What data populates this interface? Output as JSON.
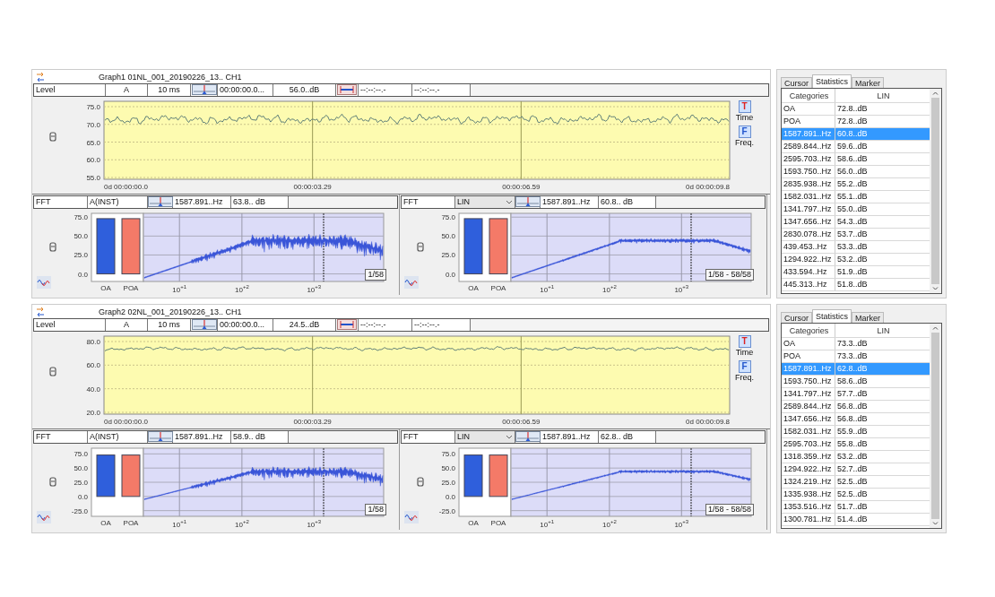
{
  "graphs": [
    {
      "title": "Graph1 01NL_001_20190226_13.. CH1",
      "level_toolbar": {
        "mode": "Level",
        "weighting": "A",
        "interval": "10 ms",
        "time": "00:00:00.0...",
        "value": "56.0..dB",
        "range_start": "--:--:--.-",
        "range_end": "--:--:--.-"
      },
      "level_chart": {
        "y_labels": [
          "75.0",
          "70.0",
          "65.0",
          "60.0",
          "55.0"
        ],
        "x_labels": [
          "0d 00:00:00.0",
          "00:00:03.29",
          "00:00:06.59",
          "0d 00:00:09.8"
        ]
      },
      "view_buttons": [
        {
          "icon": "T",
          "label": "Time"
        },
        {
          "icon": "F",
          "label": "Freq."
        }
      ],
      "fft_panes": [
        {
          "kind": "field",
          "mode": "FFT",
          "weighting": "A(INST)",
          "frequency": "1587.891..Hz",
          "value": "63.8.. dB",
          "page": "1/58",
          "x_labels": [
            "10$^{+1}$",
            "10$^{+2}$",
            "10$^{+3}$"
          ],
          "chart_data": {
            "type": "bar",
            "categories": [
              "OA",
              "POA"
            ],
            "values": [
              73,
              73
            ],
            "ylim": [
              -10,
              80
            ],
            "yticks": [
              {
                "value": 75,
                "label": "75.0"
              },
              {
                "value": 50,
                "label": "50.0"
              },
              {
                "value": 25,
                "label": "25.0"
              },
              {
                "value": 0,
                "label": "0.0"
              }
            ]
          }
        },
        {
          "kind": "dropdown",
          "mode": "FFT",
          "weighting": "LIN",
          "frequency": "1587.891..Hz",
          "value": "60.8.. dB",
          "page": "1/58 - 58/58",
          "x_labels": [
            "10$^{+1}$",
            "10$^{+2}$",
            "10$^{+3}$"
          ],
          "chart_data": {
            "type": "bar",
            "categories": [
              "OA",
              "POA"
            ],
            "values": [
              73,
              73
            ],
            "ylim": [
              -10,
              80
            ],
            "yticks": [
              {
                "value": 75,
                "label": "75.0"
              },
              {
                "value": 50,
                "label": "50.0"
              },
              {
                "value": 25,
                "label": "25.0"
              },
              {
                "value": 0,
                "label": "0.0"
              }
            ]
          }
        }
      ],
      "statistics": {
        "tabs": [
          {
            "label": "Cursor",
            "selected": false
          },
          {
            "label": "Statistics",
            "selected": true
          },
          {
            "label": "Marker",
            "selected": false
          }
        ],
        "columns": [
          "Categories",
          "LIN"
        ],
        "rows": [
          {
            "category": "OA",
            "value": "72.8..dB",
            "selected": false
          },
          {
            "category": "POA",
            "value": "72.8..dB",
            "selected": false
          },
          {
            "category": "1587.891..Hz",
            "value": "60.8..dB",
            "selected": true
          },
          {
            "category": "2589.844..Hz",
            "value": "59.6..dB",
            "selected": false
          },
          {
            "category": "2595.703..Hz",
            "value": "58.6..dB",
            "selected": false
          },
          {
            "category": "1593.750..Hz",
            "value": "56.0..dB",
            "selected": false
          },
          {
            "category": "2835.938..Hz",
            "value": "55.2..dB",
            "selected": false
          },
          {
            "category": "1582.031..Hz",
            "value": "55.1..dB",
            "selected": false
          },
          {
            "category": "1341.797..Hz",
            "value": "55.0..dB",
            "selected": false
          },
          {
            "category": "1347.656..Hz",
            "value": "54.3..dB",
            "selected": false
          },
          {
            "category": "2830.078..Hz",
            "value": "53.7..dB",
            "selected": false
          },
          {
            "category": "439.453..Hz",
            "value": "53.3..dB",
            "selected": false
          },
          {
            "category": "1294.922..Hz",
            "value": "53.2..dB",
            "selected": false
          },
          {
            "category": "433.594..Hz",
            "value": "51.9..dB",
            "selected": false
          },
          {
            "category": "445.313..Hz",
            "value": "51.8..dB",
            "selected": false
          }
        ]
      }
    },
    {
      "title": "Graph2 02NL_001_20190226_13.. CH1",
      "level_toolbar": {
        "mode": "Level",
        "weighting": "A",
        "interval": "10 ms",
        "time": "00:00:00.0...",
        "value": "24.5..dB",
        "range_start": "--:--:--.-",
        "range_end": "--:--:--.-"
      },
      "level_chart": {
        "y_labels": [
          "80.0",
          "60.0",
          "40.0",
          "20.0"
        ],
        "x_labels": [
          "0d 00:00:00.0",
          "00:00:03.29",
          "00:00:06.59",
          "0d 00:00:09.8"
        ]
      },
      "view_buttons": [
        {
          "icon": "T",
          "label": "Time"
        },
        {
          "icon": "F",
          "label": "Freq."
        }
      ],
      "fft_panes": [
        {
          "kind": "field",
          "mode": "FFT",
          "weighting": "A(INST)",
          "frequency": "1587.891..Hz",
          "value": "58.9.. dB",
          "page": "1/58",
          "x_labels": [
            "10$^{+1}$",
            "10$^{+2}$",
            "10$^{+3}$"
          ],
          "chart_data": {
            "type": "bar",
            "categories": [
              "OA",
              "POA"
            ],
            "values": [
              73,
              73
            ],
            "ylim": [
              -35,
              85
            ],
            "yticks": [
              {
                "value": 75,
                "label": "75.0"
              },
              {
                "value": 50,
                "label": "50.0"
              },
              {
                "value": 25,
                "label": "25.0"
              },
              {
                "value": 0,
                "label": "0.0"
              },
              {
                "value": -25,
                "label": "-25.0"
              }
            ]
          }
        },
        {
          "kind": "dropdown",
          "mode": "FFT",
          "weighting": "LIN",
          "frequency": "1587.891..Hz",
          "value": "62.8.. dB",
          "page": "1/58 - 58/58",
          "x_labels": [
            "10$^{+1}$",
            "10$^{+2}$",
            "10$^{+3}$"
          ],
          "chart_data": {
            "type": "bar",
            "categories": [
              "OA",
              "POA"
            ],
            "values": [
              73,
              73
            ],
            "ylim": [
              -35,
              85
            ],
            "yticks": [
              {
                "value": 75,
                "label": "75.0"
              },
              {
                "value": 50,
                "label": "50.0"
              },
              {
                "value": 25,
                "label": "25.0"
              },
              {
                "value": 0,
                "label": "0.0"
              },
              {
                "value": -25,
                "label": "-25.0"
              }
            ]
          }
        }
      ],
      "statistics": {
        "tabs": [
          {
            "label": "Cursor",
            "selected": false
          },
          {
            "label": "Statistics",
            "selected": true
          },
          {
            "label": "Marker",
            "selected": false
          }
        ],
        "columns": [
          "Categories",
          "LIN"
        ],
        "rows": [
          {
            "category": "OA",
            "value": "73.3..dB",
            "selected": false
          },
          {
            "category": "POA",
            "value": "73.3..dB",
            "selected": false
          },
          {
            "category": "1587.891..Hz",
            "value": "62.8..dB",
            "selected": true
          },
          {
            "category": "1593.750..Hz",
            "value": "58.6..dB",
            "selected": false
          },
          {
            "category": "1341.797..Hz",
            "value": "57.7..dB",
            "selected": false
          },
          {
            "category": "2589.844..Hz",
            "value": "56.8..dB",
            "selected": false
          },
          {
            "category": "1347.656..Hz",
            "value": "56.8..dB",
            "selected": false
          },
          {
            "category": "1582.031..Hz",
            "value": "55.9..dB",
            "selected": false
          },
          {
            "category": "2595.703..Hz",
            "value": "55.8..dB",
            "selected": false
          },
          {
            "category": "1318.359..Hz",
            "value": "53.2..dB",
            "selected": false
          },
          {
            "category": "1294.922..Hz",
            "value": "52.7..dB",
            "selected": false
          },
          {
            "category": "1324.219..Hz",
            "value": "52.5..dB",
            "selected": false
          },
          {
            "category": "1335.938..Hz",
            "value": "52.5..dB",
            "selected": false
          },
          {
            "category": "1353.516..Hz",
            "value": "51.7..dB",
            "selected": false
          },
          {
            "category": "1300.781..Hz",
            "value": "51.4..dB",
            "selected": false
          }
        ]
      }
    }
  ]
}
